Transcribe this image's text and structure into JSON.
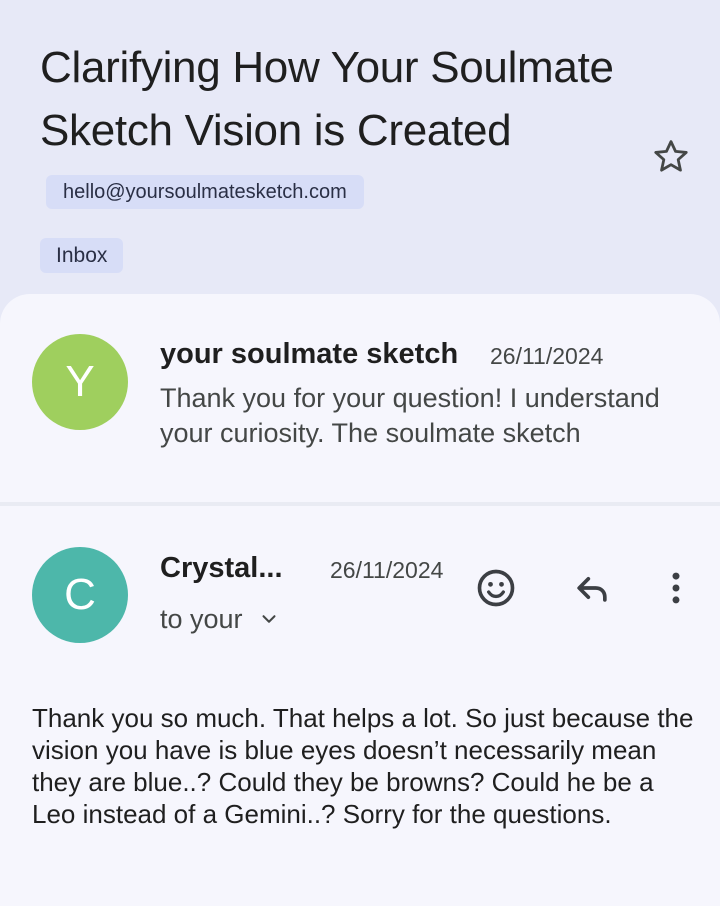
{
  "thread": {
    "subject": "Clarifying How Your Soulmate Sketch Vision is Created",
    "sender_email": "hello@yoursoulmatesketch.com",
    "label": "Inbox"
  },
  "messages": [
    {
      "avatar_letter": "Y",
      "sender": "your soulmate sketch",
      "date": "26/11/2024",
      "snippet": "Thank you for your question! I understand your curiosity. The soulmate sketch"
    },
    {
      "avatar_letter": "C",
      "sender": "Crystal...",
      "date": "26/11/2024",
      "recipient": "to your",
      "body": "Thank you so much. That helps a lot. So just because the vision you have is blue eyes doesn’t necessarily mean they are blue..? Could they be browns? Could he be a Leo instead of a Gemini..? Sorry for the questions."
    }
  ],
  "icons": {
    "star": "star-outline-icon",
    "chevron": "chevron-down-icon",
    "emoji": "emoji-react-icon",
    "reply": "reply-icon",
    "more": "more-vert-icon"
  },
  "colors": {
    "header_bg": "#e7e9f7",
    "card_bg": "#f6f6fd",
    "chip_bg": "#d7ddf7",
    "avatar_y": "#9fcf5e",
    "avatar_c": "#4db7aa"
  }
}
